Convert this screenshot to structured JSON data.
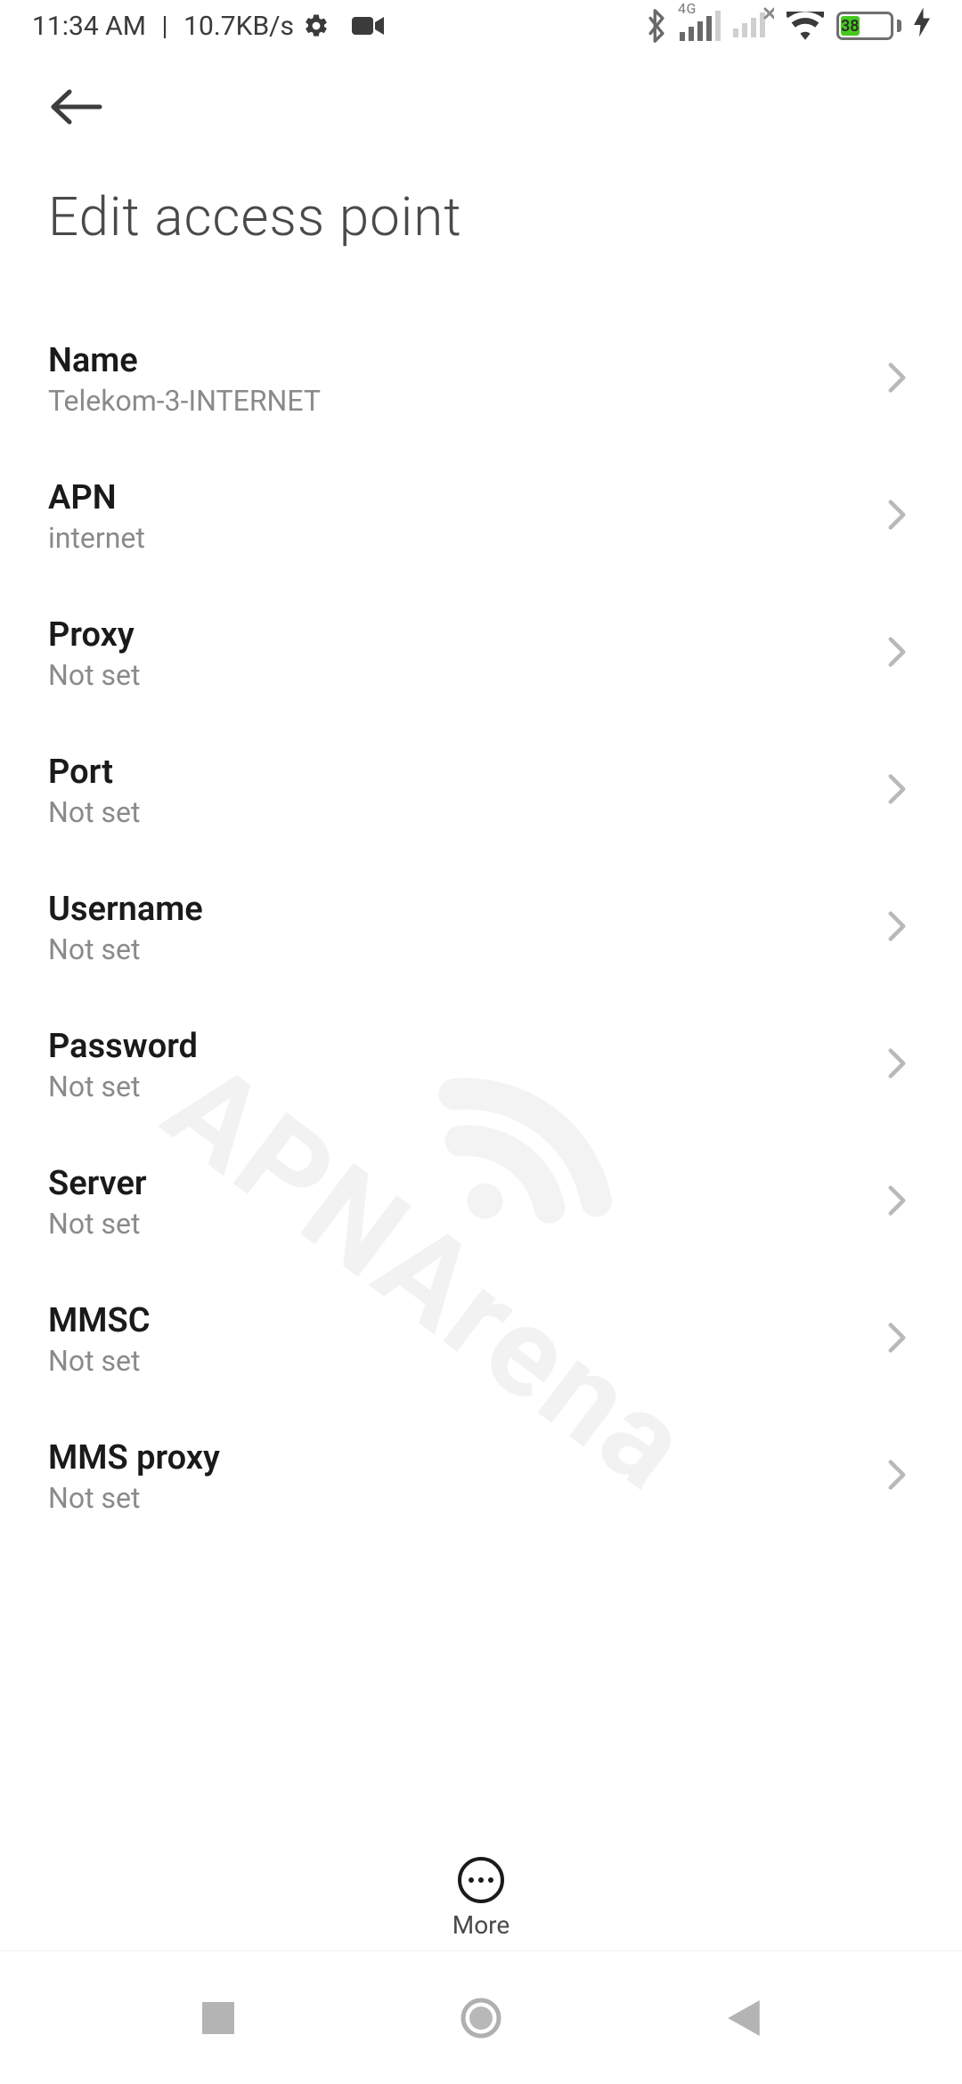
{
  "status_bar": {
    "time": "11:34 AM",
    "separator": " | ",
    "data_rate": "10.7KB/s",
    "network_badge": "4G",
    "battery_percent": "38"
  },
  "header": {
    "title": "Edit access point"
  },
  "items": [
    {
      "label": "Name",
      "value": "Telekom-3-INTERNET"
    },
    {
      "label": "APN",
      "value": "internet"
    },
    {
      "label": "Proxy",
      "value": "Not set"
    },
    {
      "label": "Port",
      "value": "Not set"
    },
    {
      "label": "Username",
      "value": "Not set"
    },
    {
      "label": "Password",
      "value": "Not set"
    },
    {
      "label": "Server",
      "value": "Not set"
    },
    {
      "label": "MMSC",
      "value": "Not set"
    },
    {
      "label": "MMS proxy",
      "value": "Not set"
    }
  ],
  "bottom_action": {
    "label": "More"
  },
  "watermark": {
    "text": "APNArena"
  }
}
